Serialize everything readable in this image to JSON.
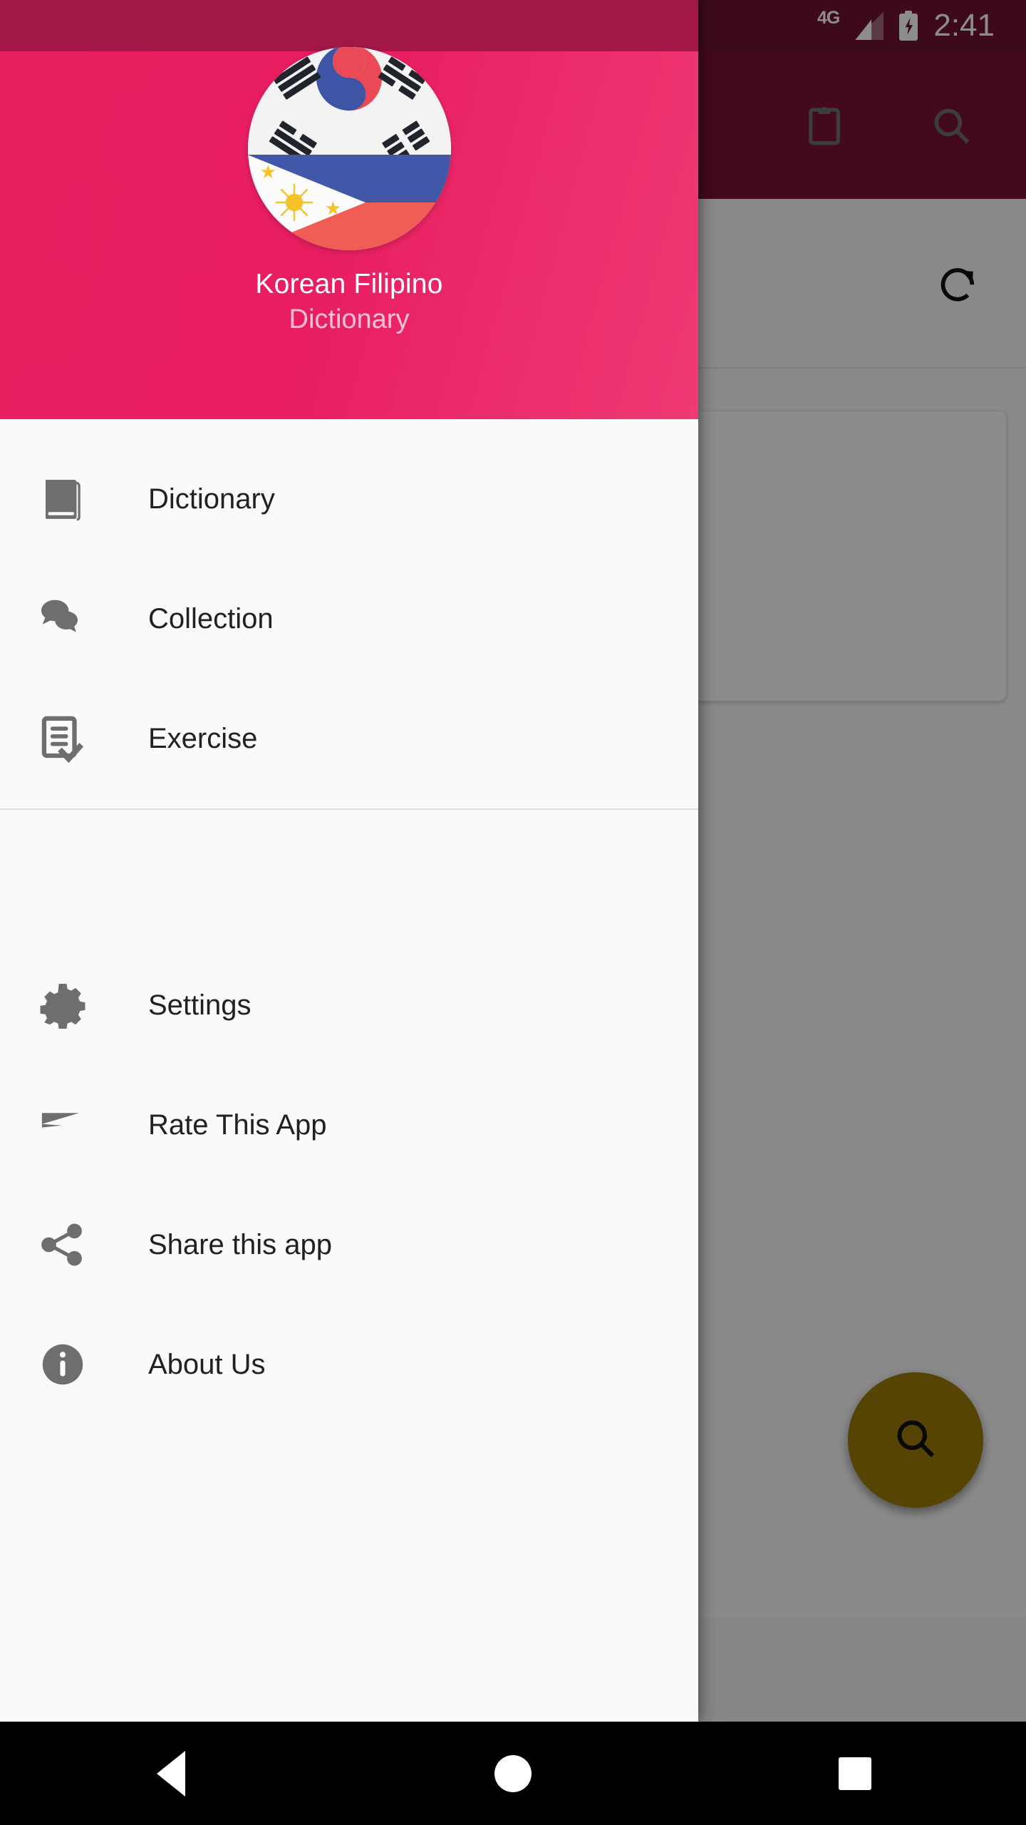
{
  "statusbar": {
    "network": "4G",
    "time": "2:41",
    "battery_icon": "battery-charging-icon",
    "signal_icon": "signal-bars-icon"
  },
  "toolbar": {
    "clipboard_icon": "clipboard-icon",
    "search_icon": "search-icon"
  },
  "background": {
    "refresh_icon": "refresh-icon",
    "toggle_state": "on",
    "fab_icon": "search-icon"
  },
  "drawer": {
    "avatar": "korean-filipino-flag-avatar",
    "title": "Korean  Filipino",
    "subtitle": "Dictionary",
    "header_color": "#e81e61",
    "primary_group": [
      {
        "label": "Dictionary",
        "icon": "book-icon"
      },
      {
        "label": "Collection",
        "icon": "chat-bubbles-icon"
      },
      {
        "label": "Exercise",
        "icon": "document-check-icon"
      }
    ],
    "secondary_group": [
      {
        "label": "Settings",
        "icon": "gear-icon"
      },
      {
        "label": "Rate This App",
        "icon": "send-icon"
      },
      {
        "label": "Share this app",
        "icon": "share-icon"
      },
      {
        "label": "About Us",
        "icon": "info-icon"
      }
    ]
  },
  "navbar": {
    "back": "back-triangle-icon",
    "home": "home-circle-icon",
    "recents": "recents-square-icon"
  },
  "colors": {
    "status_bar": "#6e1334",
    "toolbar": "#7a1236",
    "accent_pink": "#e81e61",
    "accent_gold": "#9c7c06",
    "icon_gray": "#707070"
  }
}
